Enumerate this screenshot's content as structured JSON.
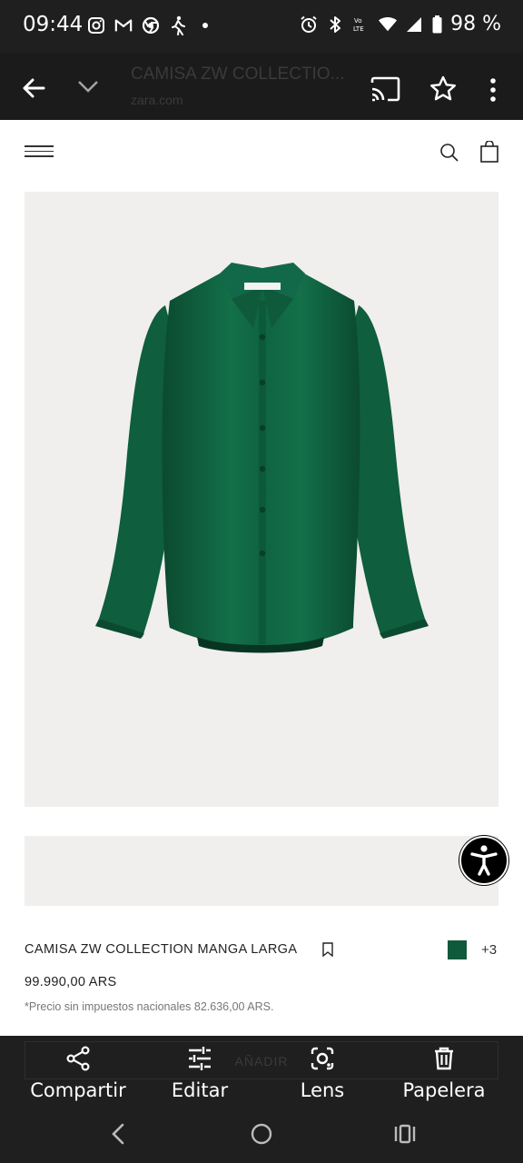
{
  "status_bar": {
    "time": "09:44",
    "battery": "98 %",
    "icons_left": [
      "instagram-icon",
      "gmail-icon",
      "chrome-icon",
      "activity-icon",
      "dot-icon"
    ],
    "icons_right": [
      "alarm-icon",
      "bluetooth-icon",
      "volte-icon",
      "wifi-icon",
      "signal-icon",
      "battery-icon"
    ]
  },
  "browser": {
    "title": "CAMISA ZW COLLECTIO...",
    "url": "zara.com"
  },
  "product": {
    "name": "CAMISA ZW COLLECTION MANGA LARGA",
    "price": "99.990,00 ARS",
    "tax_note": "*Precio sin impuestos nacionales 82.636,00 ARS.",
    "more_colors": "+3",
    "color": "#0f5a3c",
    "add_button": "AÑADIR"
  },
  "actions": [
    {
      "label": "Compartir",
      "icon": "share-icon"
    },
    {
      "label": "Editar",
      "icon": "edit-sliders-icon"
    },
    {
      "label": "Lens",
      "icon": "lens-icon"
    },
    {
      "label": "Papelera",
      "icon": "trash-icon"
    }
  ],
  "colors": {
    "system_bar": "#1f1f1f",
    "image_bg": "#f0efed",
    "shirt": "#0f5a3c"
  }
}
